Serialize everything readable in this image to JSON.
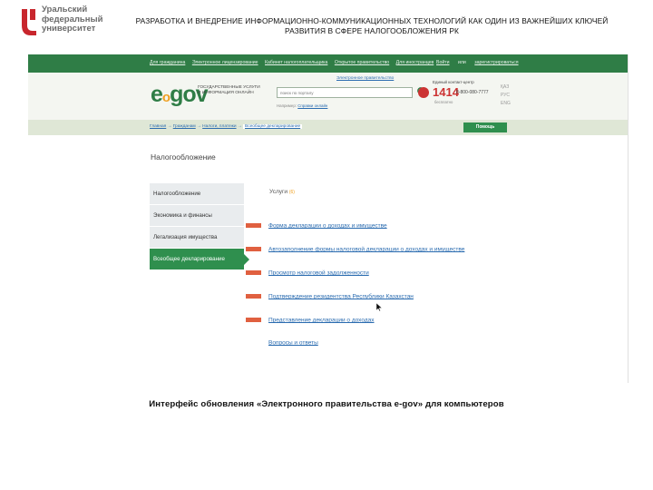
{
  "university": {
    "logo_lines": [
      "Уральский",
      "федеральный",
      "университет"
    ]
  },
  "slide": {
    "title": "РАЗРАБОТКА И ВНЕДРЕНИЕ ИНФОРМАЦИОННО-КОММУНИКАЦИОННЫХ ТЕХНОЛОГИЙ КАК ОДИН ИЗ ВАЖНЕЙШИХ КЛЮЧЕЙ РАЗВИТИЯ В СФЕРЕ НАЛОГООБЛОЖЕНИЯ РК",
    "caption": "Интерфейс обновления «Электронного правительства e-gov» для компьютеров"
  },
  "portal": {
    "topnav": [
      "Для гражданина",
      "Электронное лицензирование",
      "Кабинет налогоплательщика",
      "Открытое правительство",
      "Для иностранцев"
    ],
    "topnav_right": [
      "Войти",
      "или",
      "зарегистрироваться"
    ],
    "logo_e": "e",
    "logo_o": "o",
    "logo_gov": "gov",
    "logo_subtitle_1": "ГОСУДАРСТВЕННЫЕ УСЛУГИ",
    "logo_subtitle_2": "И ИНФОРМАЦИЯ ОНЛАЙН",
    "mobile_link": "Электронное правительство",
    "search_placeholder": "поиск по порталу",
    "search_hint_prefix": "Например:",
    "search_hint_link": "Справки онлайн",
    "callcenter_label": "Единый контакт-центр",
    "callcenter_number": "1414",
    "callcenter_number2": "8-800-080-7777",
    "callcenter_free": "бесплатно",
    "languages": [
      "ҚАЗ",
      "РУС",
      "ENG"
    ],
    "breadcrumbs": [
      "Главная",
      "Гражданам",
      "Налоги, платежи",
      "Всеобщее декларирование"
    ],
    "help_button": "Помощь",
    "page_title": "Налогообложение",
    "side_menu": [
      "Налогообложение",
      "Экономика и финансы",
      "Легализация имущества",
      "Всеобщее декларирование"
    ],
    "side_menu_active_index": 3,
    "services_title": "Услуги",
    "services_subtitle": "(6)",
    "services": [
      {
        "label": "Форма декларации о доходах и имуществе",
        "badge": true
      },
      {
        "label": "Автозаполнение формы налоговой декларации о доходах и имуществе",
        "badge": true
      },
      {
        "label": "Просмотр налоговой задолженности",
        "badge": true
      },
      {
        "label": "Подтверждение резидентства Республики Казахстан",
        "badge": true
      },
      {
        "label": "Представление декларации о доходах",
        "badge": true
      },
      {
        "label": "Вопросы и ответы",
        "badge": false
      }
    ]
  },
  "colors": {
    "brand_green": "#2f7d46",
    "accent_orange": "#f0a020",
    "badge_red": "#e06040",
    "link_blue": "#2b6cb0",
    "logo_red": "#c8262d"
  }
}
